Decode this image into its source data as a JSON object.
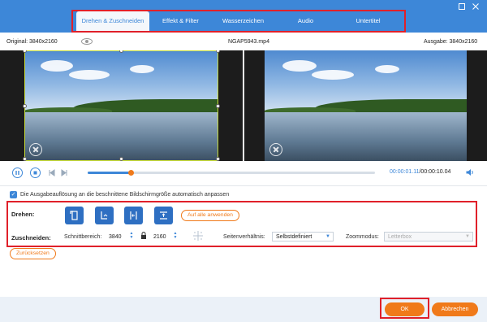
{
  "colors": {
    "titlebar": "#3d87d8",
    "accent": "#3d87d8",
    "orange": "#f07a1a",
    "highlight_box": "#e0202a",
    "crop_frame": "#c8dc3a"
  },
  "tabs": [
    {
      "label": "Drehen & Zuschneiden",
      "active": true
    },
    {
      "label": "Effekt & Filter",
      "active": false
    },
    {
      "label": "Wasserzeichen",
      "active": false
    },
    {
      "label": "Audio",
      "active": false
    },
    {
      "label": "Untertitel",
      "active": false
    }
  ],
  "window": {
    "restore_icon": "restore-icon",
    "close_icon": "close-icon"
  },
  "info": {
    "original": "Original: 3840x2160",
    "filename": "NGAP5943.mp4",
    "output": "Ausgabe: 3840x2160"
  },
  "player": {
    "current_time": "00:00:01.11",
    "separator": "/",
    "total_time": "00:00:10.04",
    "progress": 0.15
  },
  "options": {
    "auto_adjust_label": "Die Ausgabeauflösung an die beschnittene Bildschirmgröße automatisch anpassen",
    "auto_adjust_checked": true
  },
  "rotate": {
    "label": "Drehen:",
    "buttons": [
      {
        "icon": "rotate-left-icon"
      },
      {
        "icon": "rotate-right-icon"
      },
      {
        "icon": "flip-horizontal-icon"
      },
      {
        "icon": "flip-vertical-icon"
      }
    ],
    "apply_all": "Auf alle anwenden"
  },
  "crop": {
    "label": "Zuschneiden:",
    "area_label": "Schnittbereich:",
    "width": "3840",
    "height": "2160",
    "aspect_label": "Seitenverhältnis:",
    "aspect_value": "Selbstdefiniert",
    "zoom_label": "Zoommodus:",
    "zoom_value": "Letterbox"
  },
  "reset_label": "Zurücksetzen",
  "footer": {
    "ok": "OK",
    "cancel": "Abbrechen"
  }
}
